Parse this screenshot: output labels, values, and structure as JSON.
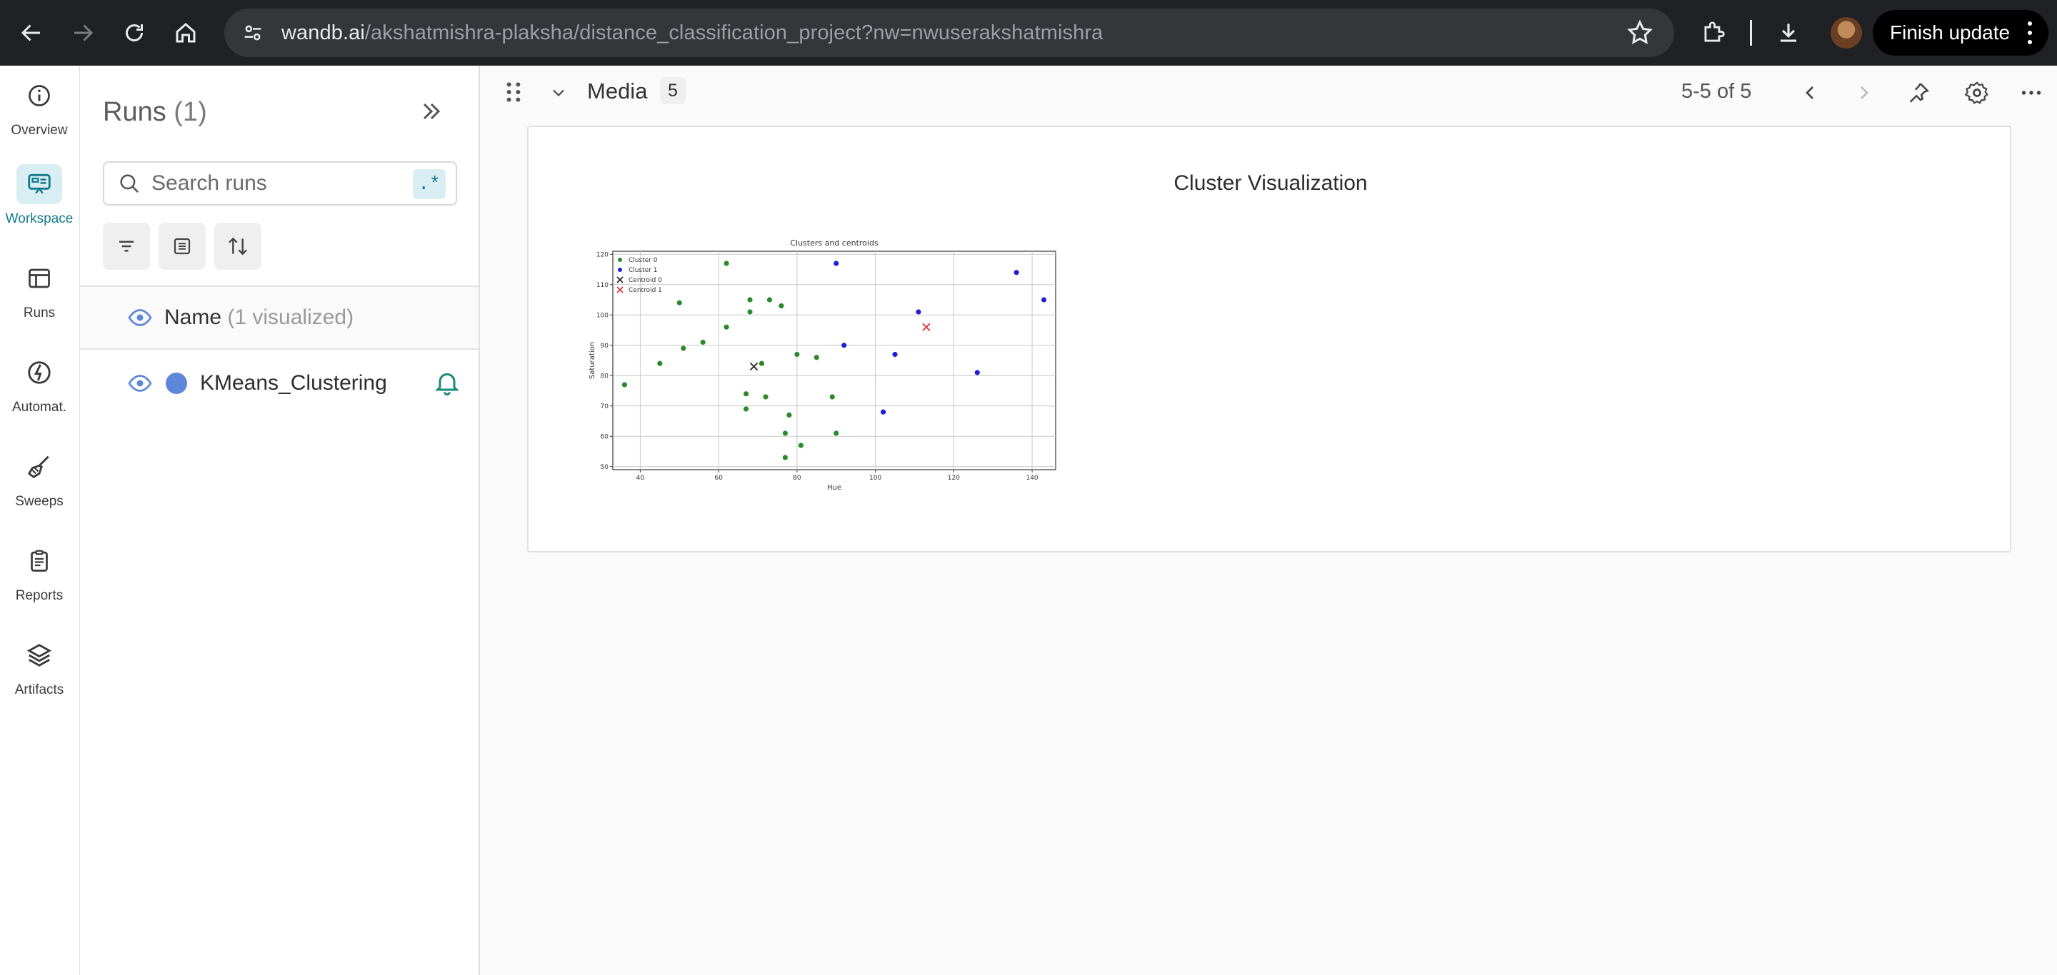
{
  "browser": {
    "url_host": "wandb.ai",
    "url_path": "/akshatmishra-plaksha/distance_classification_project?nw=nwuserakshatmishra",
    "finish_update_label": "Finish update"
  },
  "leftnav": {
    "items": [
      {
        "label": "Overview",
        "icon": "info-icon"
      },
      {
        "label": "Workspace",
        "icon": "workspace-icon",
        "active": true
      },
      {
        "label": "Runs",
        "icon": "table-icon"
      },
      {
        "label": "Automat.",
        "icon": "automation-icon"
      },
      {
        "label": "Sweeps",
        "icon": "broom-icon"
      },
      {
        "label": "Reports",
        "icon": "clipboard-icon"
      },
      {
        "label": "Artifacts",
        "icon": "layers-icon"
      }
    ]
  },
  "runs_panel": {
    "title": "Runs",
    "count": "(1)",
    "search_placeholder": "Search runs",
    "regex_label": ".*",
    "header_name": "Name",
    "header_visualized": "(1 visualized)",
    "runs": [
      {
        "name": "KMeans_Clustering",
        "color": "#5d88d9"
      }
    ]
  },
  "section": {
    "title": "Media",
    "count": "5",
    "pager": "5-5 of 5"
  },
  "panel": {
    "title": "Cluster Visualization"
  },
  "chart_data": {
    "type": "scatter",
    "title": "Clusters and centroids",
    "xlabel": "Hue",
    "ylabel": "Saturation",
    "xlim": [
      33,
      146
    ],
    "ylim": [
      49,
      121
    ],
    "xticks": [
      "40",
      "60",
      "80",
      "100",
      "120",
      "140"
    ],
    "yticks": [
      "50",
      "60",
      "70",
      "80",
      "90",
      "100",
      "110",
      "120"
    ],
    "grid": true,
    "legend_position": "top-left",
    "series": [
      {
        "name": "Cluster 0",
        "color": "#2a8a2a",
        "marker": "dot",
        "x": [
          36,
          45,
          50,
          51,
          56,
          62,
          62,
          67,
          67,
          68,
          68,
          71,
          72,
          73,
          76,
          77,
          77,
          78,
          80,
          81,
          85,
          89,
          90
        ],
        "y": [
          77,
          84,
          104,
          89,
          91,
          117,
          96,
          74,
          69,
          105,
          101,
          84,
          73,
          105,
          103,
          61,
          53,
          67,
          87,
          57,
          86,
          73,
          61
        ]
      },
      {
        "name": "Cluster 1",
        "color": "#1f1fd8",
        "marker": "dot",
        "x": [
          90,
          92,
          102,
          105,
          111,
          126,
          136,
          143
        ],
        "y": [
          117,
          90,
          68,
          87,
          101,
          81,
          114,
          105
        ]
      },
      {
        "name": "Centroid 0",
        "color": "#222222",
        "marker": "x",
        "x": [
          69
        ],
        "y": [
          83
        ]
      },
      {
        "name": "Centroid 1",
        "color": "#e03030",
        "marker": "x",
        "x": [
          113
        ],
        "y": [
          96
        ]
      }
    ]
  }
}
